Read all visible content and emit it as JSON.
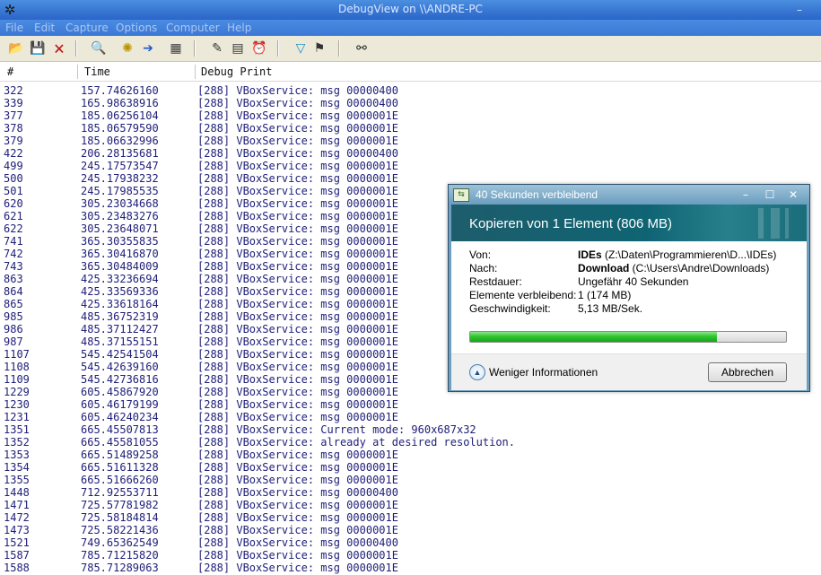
{
  "window": {
    "title": "DebugView on \\\\ANDRE-PC"
  },
  "menu": [
    "File",
    "Edit",
    "Capture",
    "Options",
    "Computer",
    "Help"
  ],
  "toolbar": [
    {
      "name": "open-icon",
      "glyph": "📂"
    },
    {
      "name": "save-icon",
      "glyph": "💾"
    },
    {
      "name": "clear-icon",
      "glyph": "🗙"
    },
    {
      "name": "find-icon",
      "glyph": "🔍"
    },
    {
      "name": "capture-icon",
      "glyph": "✺"
    },
    {
      "name": "autoscroll-icon",
      "glyph": "➔"
    },
    {
      "name": "capture-kernel-icon",
      "glyph": "▦"
    },
    {
      "name": "history-icon",
      "glyph": "✎"
    },
    {
      "name": "properties-icon",
      "glyph": "▤"
    },
    {
      "name": "time-icon",
      "glyph": "⏰"
    },
    {
      "name": "filter-icon",
      "glyph": "▽"
    },
    {
      "name": "highlight-icon",
      "glyph": "⚑"
    },
    {
      "name": "search-binoculars-icon",
      "glyph": "⚯"
    }
  ],
  "columns": [
    "#",
    "Time",
    "Debug Print"
  ],
  "rows": [
    [
      "322",
      "157.74626160",
      "[288] VBoxService: msg 00000400"
    ],
    [
      "339",
      "165.98638916",
      "[288] VBoxService: msg 00000400"
    ],
    [
      "377",
      "185.06256104",
      "[288] VBoxService: msg 0000001E"
    ],
    [
      "378",
      "185.06579590",
      "[288] VBoxService: msg 0000001E"
    ],
    [
      "379",
      "185.06632996",
      "[288] VBoxService: msg 0000001E"
    ],
    [
      "422",
      "206.28135681",
      "[288] VBoxService: msg 00000400"
    ],
    [
      "499",
      "245.17573547",
      "[288] VBoxService: msg 0000001E"
    ],
    [
      "500",
      "245.17938232",
      "[288] VBoxService: msg 0000001E"
    ],
    [
      "501",
      "245.17985535",
      "[288] VBoxService: msg 0000001E"
    ],
    [
      "620",
      "305.23034668",
      "[288] VBoxService: msg 0000001E"
    ],
    [
      "621",
      "305.23483276",
      "[288] VBoxService: msg 0000001E"
    ],
    [
      "622",
      "305.23648071",
      "[288] VBoxService: msg 0000001E"
    ],
    [
      "741",
      "365.30355835",
      "[288] VBoxService: msg 0000001E"
    ],
    [
      "742",
      "365.30416870",
      "[288] VBoxService: msg 0000001E"
    ],
    [
      "743",
      "365.30484009",
      "[288] VBoxService: msg 0000001E"
    ],
    [
      "863",
      "425.33236694",
      "[288] VBoxService: msg 0000001E"
    ],
    [
      "864",
      "425.33569336",
      "[288] VBoxService: msg 0000001E"
    ],
    [
      "865",
      "425.33618164",
      "[288] VBoxService: msg 0000001E"
    ],
    [
      "985",
      "485.36752319",
      "[288] VBoxService: msg 0000001E"
    ],
    [
      "986",
      "485.37112427",
      "[288] VBoxService: msg 0000001E"
    ],
    [
      "987",
      "485.37155151",
      "[288] VBoxService: msg 0000001E"
    ],
    [
      "1107",
      "545.42541504",
      "[288] VBoxService: msg 0000001E"
    ],
    [
      "1108",
      "545.42639160",
      "[288] VBoxService: msg 0000001E"
    ],
    [
      "1109",
      "545.42736816",
      "[288] VBoxService: msg 0000001E"
    ],
    [
      "1229",
      "605.45867920",
      "[288] VBoxService: msg 0000001E"
    ],
    [
      "1230",
      "605.46179199",
      "[288] VBoxService: msg 0000001E"
    ],
    [
      "1231",
      "605.46240234",
      "[288] VBoxService: msg 0000001E"
    ],
    [
      "1351",
      "665.45507813",
      "[288] VBoxService: Current mode: 960x687x32"
    ],
    [
      "1352",
      "665.45581055",
      "[288] VBoxService: already at desired resolution."
    ],
    [
      "1353",
      "665.51489258",
      "[288] VBoxService: msg 0000001E"
    ],
    [
      "1354",
      "665.51611328",
      "[288] VBoxService: msg 0000001E"
    ],
    [
      "1355",
      "665.51666260",
      "[288] VBoxService: msg 0000001E"
    ],
    [
      "1448",
      "712.92553711",
      "[288] VBoxService: msg 00000400"
    ],
    [
      "1471",
      "725.57781982",
      "[288] VBoxService: msg 0000001E"
    ],
    [
      "1472",
      "725.58184814",
      "[288] VBoxService: msg 0000001E"
    ],
    [
      "1473",
      "725.58221436",
      "[288] VBoxService: msg 0000001E"
    ],
    [
      "1521",
      "749.65362549",
      "[288] VBoxService: msg 00000400"
    ],
    [
      "1587",
      "785.71215820",
      "[288] VBoxService: msg 0000001E"
    ],
    [
      "1588",
      "785.71289063",
      "[288] VBoxService: msg 0000001E"
    ]
  ],
  "dialog": {
    "title": "40 Sekunden verbleibend",
    "heading": "Kopieren von 1 Element (806 MB)",
    "rows": [
      {
        "label": "Von:",
        "bold": "IDEs",
        "value": " (Z:\\Daten\\Programmieren\\D...\\IDEs)"
      },
      {
        "label": "Nach:",
        "bold": "Download",
        "value": " (C:\\Users\\Andre\\Downloads)"
      },
      {
        "label": "Restdauer:",
        "bold": "",
        "value": "Ungefähr 40 Sekunden"
      },
      {
        "label": "Elemente verbleibend:",
        "bold": "",
        "value": "1 (174 MB)"
      },
      {
        "label": "Geschwindigkeit:",
        "bold": "",
        "value": "5,13 MB/Sek."
      }
    ],
    "progress": 0.78,
    "less_info": "Weniger Informationen",
    "cancel": "Abbrechen"
  },
  "colors": {
    "log_text": "#20207a",
    "progress_green": "#1aa41a",
    "dialog_header": "#0f6473"
  }
}
